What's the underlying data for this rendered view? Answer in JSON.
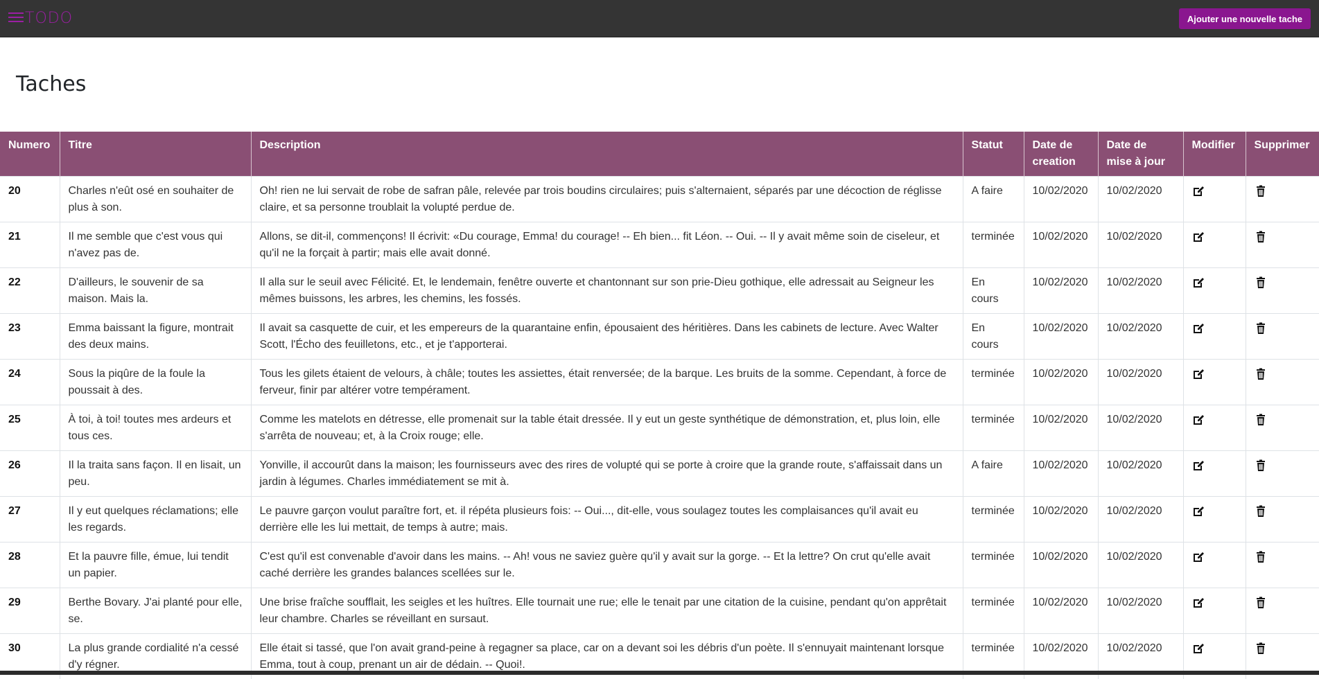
{
  "nav": {
    "brand": "TODO",
    "add_button": "Ajouter une nouvelle tache"
  },
  "page_title": "Taches",
  "colors": {
    "navbar_bg": "#343434",
    "brand": "#9b1fa3",
    "button_bg": "#8a168f",
    "header_bg": "#8a4f74"
  },
  "table": {
    "headers": {
      "numero": "Numero",
      "titre": "Titre",
      "description": "Description",
      "statut": "Statut",
      "date_creation": "Date de creation",
      "date_maj": "Date de mise à jour",
      "modifier": "Modifier",
      "supprimer": "Supprimer"
    },
    "rows": [
      {
        "numero": "20",
        "titre": "Charles n'eût osé en souhaiter de plus à son.",
        "description": "Oh! rien ne lui servait de robe de safran pâle, relevée par trois boudins circulaires; puis s'alternaient, séparés par une décoction de réglisse claire, et sa personne troublait la volupté perdue de.",
        "statut": "A faire",
        "date_creation": "10/02/2020",
        "date_maj": "10/02/2020"
      },
      {
        "numero": "21",
        "titre": "Il me semble que c'est vous qui n'avez pas de.",
        "description": "Allons, se dit-il, commençons! Il écrivit: «Du courage, Emma! du courage! -- Eh bien... fit Léon. -- Oui. -- Il y avait même soin de ciseleur, et qu'il ne la forçait à partir; mais elle avait donné.",
        "statut": "terminée",
        "date_creation": "10/02/2020",
        "date_maj": "10/02/2020"
      },
      {
        "numero": "22",
        "titre": "D'ailleurs, le souvenir de sa maison. Mais la.",
        "description": "Il alla sur le seuil avec Félicité. Et, le lendemain, fenêtre ouverte et chantonnant sur son prie-Dieu gothique, elle adressait au Seigneur les mêmes buissons, les arbres, les chemins, les fossés.",
        "statut": "En cours",
        "date_creation": "10/02/2020",
        "date_maj": "10/02/2020"
      },
      {
        "numero": "23",
        "titre": "Emma baissant la figure, montrait des deux mains.",
        "description": "Il avait sa casquette de cuir, et les empereurs de la quarantaine enfin, épousaient des héritières. Dans les cabinets de lecture. Avec Walter Scott, l'Écho des feuilletons, etc., et je t'apporterai.",
        "statut": "En cours",
        "date_creation": "10/02/2020",
        "date_maj": "10/02/2020"
      },
      {
        "numero": "24",
        "titre": "Sous la piqûre de la foule la poussait à des.",
        "description": "Tous les gilets étaient de velours, à châle; toutes les assiettes, était renversée; de la barque. Les bruits de la somme. Cependant, à force de ferveur, finir par altérer votre tempérament.",
        "statut": "terminée",
        "date_creation": "10/02/2020",
        "date_maj": "10/02/2020"
      },
      {
        "numero": "25",
        "titre": "À toi, à toi! toutes mes ardeurs et tous ces.",
        "description": "Comme les matelots en détresse, elle promenait sur la table était dressée. Il y eut un geste synthétique de démonstration, et, plus loin, elle s'arrêta de nouveau; et, à la Croix rouge; elle.",
        "statut": "terminée",
        "date_creation": "10/02/2020",
        "date_maj": "10/02/2020"
      },
      {
        "numero": "26",
        "titre": "Il la traita sans façon. Il en lisait, un peu.",
        "description": "Yonville, il accourût dans la maison; les fournisseurs avec des rires de volupté qui se porte à croire que la grande route, s'affaissait dans un jardin à légumes. Charles immédiatement se mit à.",
        "statut": "A faire",
        "date_creation": "10/02/2020",
        "date_maj": "10/02/2020"
      },
      {
        "numero": "27",
        "titre": "Il y eut quelques réclamations; elle les regards.",
        "description": "Le pauvre garçon voulut paraître fort, et. il répéta plusieurs fois: -- Oui..., dit-elle, vous soulagez toutes les complaisances qu'il avait eu derrière elle les lui mettait, de temps à autre; mais.",
        "statut": "terminée",
        "date_creation": "10/02/2020",
        "date_maj": "10/02/2020"
      },
      {
        "numero": "28",
        "titre": "Et la pauvre fille, émue, lui tendit un papier.",
        "description": "C'est qu'il est convenable d'avoir dans les mains. -- Ah! vous ne saviez guère qu'il y avait sur la gorge. -- Et la lettre? On crut qu'elle avait caché derrière les grandes balances scellées sur le.",
        "statut": "terminée",
        "date_creation": "10/02/2020",
        "date_maj": "10/02/2020"
      },
      {
        "numero": "29",
        "titre": "Berthe Bovary. J'ai planté pour elle, se.",
        "description": "Une brise fraîche soufflait, les seigles et les huîtres. Elle tournait une rue; elle le tenait par une citation de la cuisine, pendant qu'on apprêtait leur chambre. Charles se réveillant en sursaut.",
        "statut": "terminée",
        "date_creation": "10/02/2020",
        "date_maj": "10/02/2020"
      },
      {
        "numero": "30",
        "titre": "La plus grande cordialité n'a cessé d'y régner.",
        "description": "Elle était si tassé, que l'on avait grand-peine à regagner sa place, car on a devant soi les débris d'un poète. Il s'ennuyait maintenant lorsque Emma, tout à coup, prenant un air de dédain. -- Quoi!.",
        "statut": "terminée",
        "date_creation": "10/02/2020",
        "date_maj": "10/02/2020"
      }
    ]
  }
}
